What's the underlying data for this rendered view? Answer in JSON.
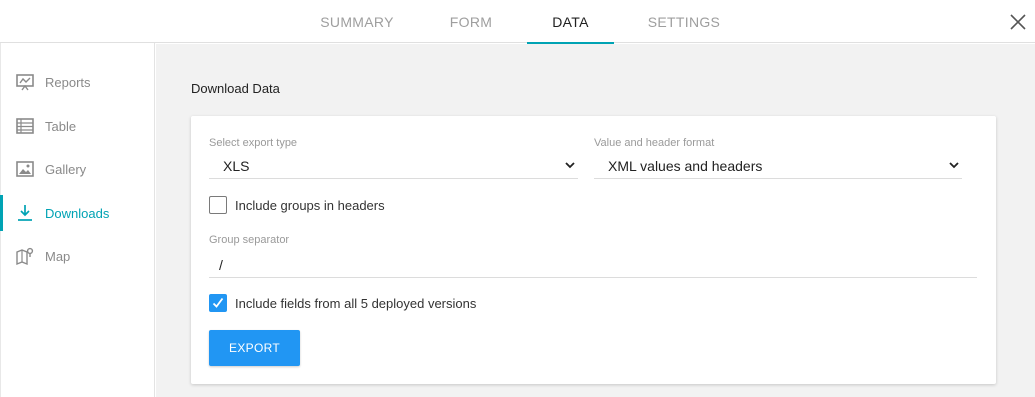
{
  "tabs": [
    {
      "label": "SUMMARY",
      "active": false
    },
    {
      "label": "FORM",
      "active": false
    },
    {
      "label": "DATA",
      "active": true
    },
    {
      "label": "SETTINGS",
      "active": false
    }
  ],
  "sidebar": {
    "items": [
      {
        "label": "Reports",
        "icon": "presentation-chart-icon",
        "active": false
      },
      {
        "label": "Table",
        "icon": "table-icon",
        "active": false
      },
      {
        "label": "Gallery",
        "icon": "image-gallery-icon",
        "active": false
      },
      {
        "label": "Downloads",
        "icon": "download-icon",
        "active": true
      },
      {
        "label": "Map",
        "icon": "map-pin-icon",
        "active": false
      }
    ]
  },
  "main": {
    "section_title": "Download Data",
    "export_type": {
      "label": "Select export type",
      "value": "XLS"
    },
    "format": {
      "label": "Value and header format",
      "value": "XML values and headers"
    },
    "include_groups": {
      "label": "Include groups in headers",
      "checked": false
    },
    "group_separator": {
      "label": "Group separator",
      "value": "/"
    },
    "include_fields": {
      "label": "Include fields from all 5 deployed versions",
      "checked": true
    },
    "export_button": "EXPORT"
  },
  "colors": {
    "accent": "#00a3b4",
    "primary_button": "#2196f3",
    "background": "#f2f2f2"
  }
}
